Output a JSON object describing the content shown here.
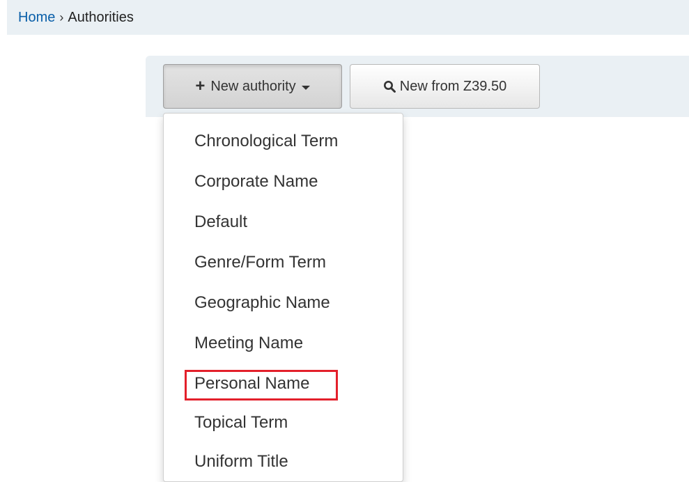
{
  "breadcrumb": {
    "home": "Home",
    "separator": "›",
    "current": "Authorities"
  },
  "toolbar": {
    "new_authority_label": "New authority",
    "new_from_z3950_label": "New from Z39.50"
  },
  "dropdown": {
    "items": [
      {
        "label": "Chronological Term"
      },
      {
        "label": "Corporate Name"
      },
      {
        "label": "Default"
      },
      {
        "label": "Genre/Form Term"
      },
      {
        "label": "Geographic Name"
      },
      {
        "label": "Meeting Name"
      },
      {
        "label": "Personal Name",
        "highlighted": true
      },
      {
        "label": "Topical Term"
      },
      {
        "label": "Uniform Title"
      }
    ]
  },
  "colors": {
    "link": "#0a5fa9",
    "highlight": "#e3202b",
    "toolbar_bg": "#eaf0f4"
  }
}
